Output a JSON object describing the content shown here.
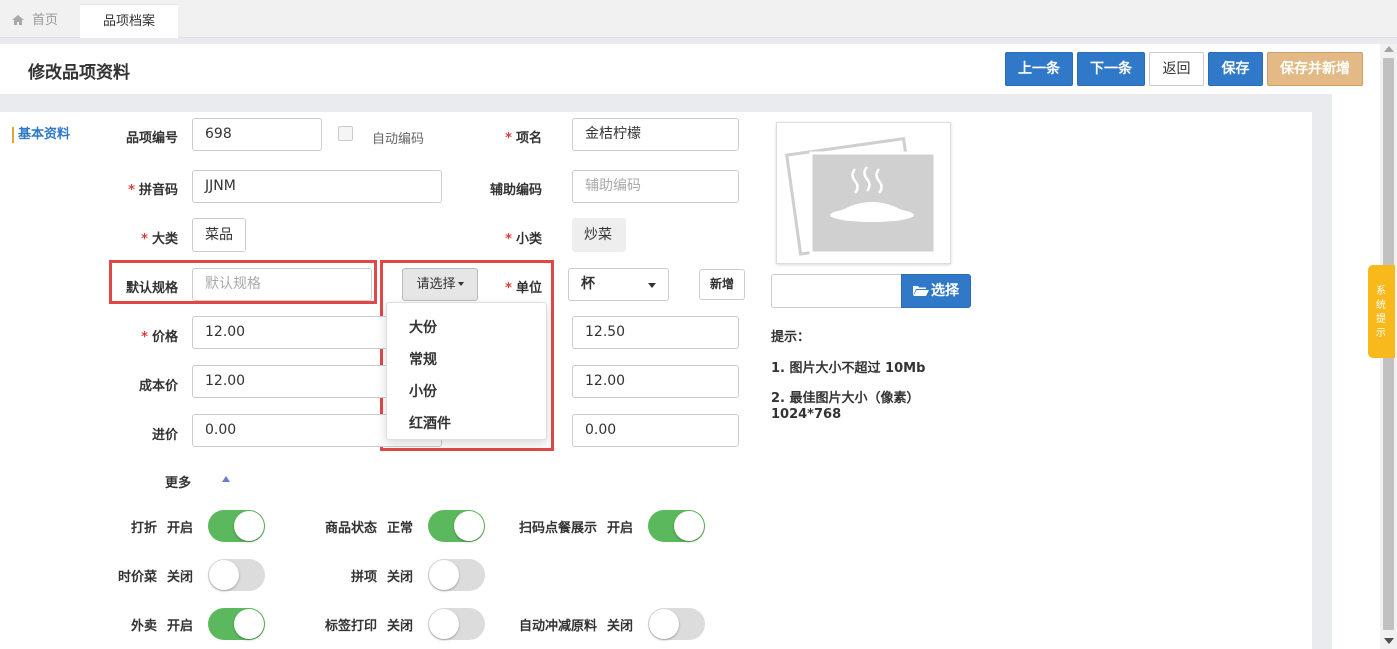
{
  "tabs": {
    "home": "首页",
    "active": "品项档案"
  },
  "header": {
    "title": "修改品项资料",
    "buttons": {
      "prev": "上一条",
      "next": "下一条",
      "back": "返回",
      "save": "保存",
      "save_new": "保存并新增"
    }
  },
  "section": "基本资料",
  "form": {
    "item_code_label": "品项编号",
    "item_code_value": "698",
    "auto_code_label": "自动编码",
    "name_label": "项名",
    "name_value": "金桔柠檬",
    "pinyin_label": "拼音码",
    "pinyin_value": "JJNM",
    "aux_code_label": "辅助编码",
    "aux_code_placeholder": "辅助编码",
    "category_label": "大类",
    "category_value": "菜品",
    "subcategory_label": "小类",
    "subcategory_value": "炒菜",
    "default_spec_label": "默认规格",
    "default_spec_placeholder": "默认规格",
    "spec_select_label": "请选择",
    "unit_label": "单位",
    "unit_value": "杯",
    "add_unit_button": "新增",
    "price_label": "价格",
    "price_value": "12.00",
    "price_right_value": "12.50",
    "cost_label": "成本价",
    "cost_value": "12.00",
    "cost_right_value": "12.00",
    "purchase_label": "进价",
    "purchase_value": "0.00",
    "purchase_right_value": "0.00",
    "spec_options": [
      "大份",
      "常规",
      "小份",
      "红酒件"
    ]
  },
  "image": {
    "choose_button": "选择",
    "hint_title": "提示：",
    "hint_1": "1. 图片大小不超过 10Mb",
    "hint_2": "2. 最佳图片大小（像素）",
    "hint_3": "1024*768"
  },
  "more": "更多",
  "toggles": [
    {
      "label": "打折",
      "state": "开启",
      "on": true
    },
    {
      "label": "商品状态",
      "state": "正常",
      "on": true
    },
    {
      "label": "扫码点餐展示",
      "state": "开启",
      "on": true
    },
    {
      "label": "时价菜",
      "state": "关闭",
      "on": false
    },
    {
      "label": "拼项",
      "state": "关闭",
      "on": false
    },
    {
      "label": "外卖",
      "state": "开启",
      "on": true
    },
    {
      "label": "标签打印",
      "state": "关闭",
      "on": false
    },
    {
      "label": "自动冲减原料",
      "state": "关闭",
      "on": false
    }
  ],
  "side_tab": "系统提示",
  "colors": {
    "primary": "#3079c8",
    "accent": "#e3b985",
    "toggle_on": "#5cb85c",
    "highlight": "#e04848",
    "side_tab": "#f7b91c"
  }
}
